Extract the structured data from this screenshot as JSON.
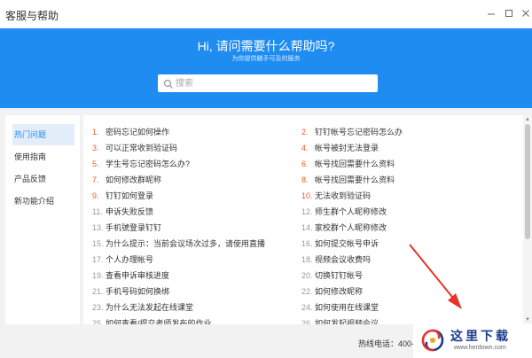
{
  "window": {
    "title": "客服与帮助",
    "minimize_icon": "minimize-icon",
    "maximize_icon": "maximize-icon",
    "close_icon": "close-icon"
  },
  "banner": {
    "heading": "Hi, 请问需要什么帮助吗?",
    "subheading": "为你提供触手可及的服务",
    "background": "#1f8cf2"
  },
  "search": {
    "placeholder": "搜索",
    "icon": "search-icon"
  },
  "sidebar": {
    "items": [
      {
        "label": "热门问题",
        "active": true
      },
      {
        "label": "使用指南",
        "active": false
      },
      {
        "label": "产品反馈",
        "active": false
      },
      {
        "label": "新功能介绍",
        "active": false
      }
    ]
  },
  "questions": {
    "left": [
      {
        "num": "1.",
        "text": "密码忘记如何操作",
        "hot": true
      },
      {
        "num": "3.",
        "text": "可以正常收到验证码",
        "hot": true
      },
      {
        "num": "5.",
        "text": "学生号忘记密码怎么办?",
        "hot": true
      },
      {
        "num": "7.",
        "text": "如何修改群昵称",
        "hot": true
      },
      {
        "num": "9.",
        "text": "钉钉如何登录",
        "hot": true
      },
      {
        "num": "11.",
        "text": "申诉失败反馈",
        "hot": false
      },
      {
        "num": "13.",
        "text": "手机號登录钉钉",
        "hot": false
      },
      {
        "num": "15.",
        "text": "为什么提示：当前会议场次过多，请使用直播",
        "hot": false
      },
      {
        "num": "17.",
        "text": "个人办理帐号",
        "hot": false
      },
      {
        "num": "19.",
        "text": "查看申诉审核进度",
        "hot": false
      },
      {
        "num": "21.",
        "text": "手机号码如何换绑",
        "hot": false
      },
      {
        "num": "23.",
        "text": "为什么无法发起在线课堂",
        "hot": false
      },
      {
        "num": "25.",
        "text": "如何查看/提交老师发布的作业",
        "hot": false
      }
    ],
    "right": [
      {
        "num": "2.",
        "text": "钉钉帐号忘记密码怎么办",
        "hot": true
      },
      {
        "num": "4.",
        "text": "帐号被封无法登录",
        "hot": true
      },
      {
        "num": "6.",
        "text": "帐号找回需要什么资料",
        "hot": true
      },
      {
        "num": "8.",
        "text": "帐号找回需要什么资料",
        "hot": true
      },
      {
        "num": "10.",
        "text": "无法收到验证码",
        "hot": true
      },
      {
        "num": "12.",
        "text": "师生群个人昵称修改",
        "hot": false
      },
      {
        "num": "14.",
        "text": "家校群个人昵称修改",
        "hot": false
      },
      {
        "num": "16.",
        "text": "如何提交帐号申诉",
        "hot": false
      },
      {
        "num": "18.",
        "text": "视频会议收费吗",
        "hot": false
      },
      {
        "num": "20.",
        "text": "切换钉钉帐号",
        "hot": false
      },
      {
        "num": "22.",
        "text": "如何修改昵称",
        "hot": false
      },
      {
        "num": "24.",
        "text": "如何使用在线课堂",
        "hot": false
      },
      {
        "num": "26.",
        "text": "如何发起视频会议",
        "hot": false
      }
    ]
  },
  "footer": {
    "hotline": "热线电话：400-"
  },
  "watermark": {
    "text": "这里下载",
    "url": "www.herdown.com",
    "logo_icon": "swirl-logo-icon"
  },
  "colors": {
    "accent": "#1f8cf2",
    "hot_number": "#f05a28",
    "arrow": "#e8322a"
  }
}
